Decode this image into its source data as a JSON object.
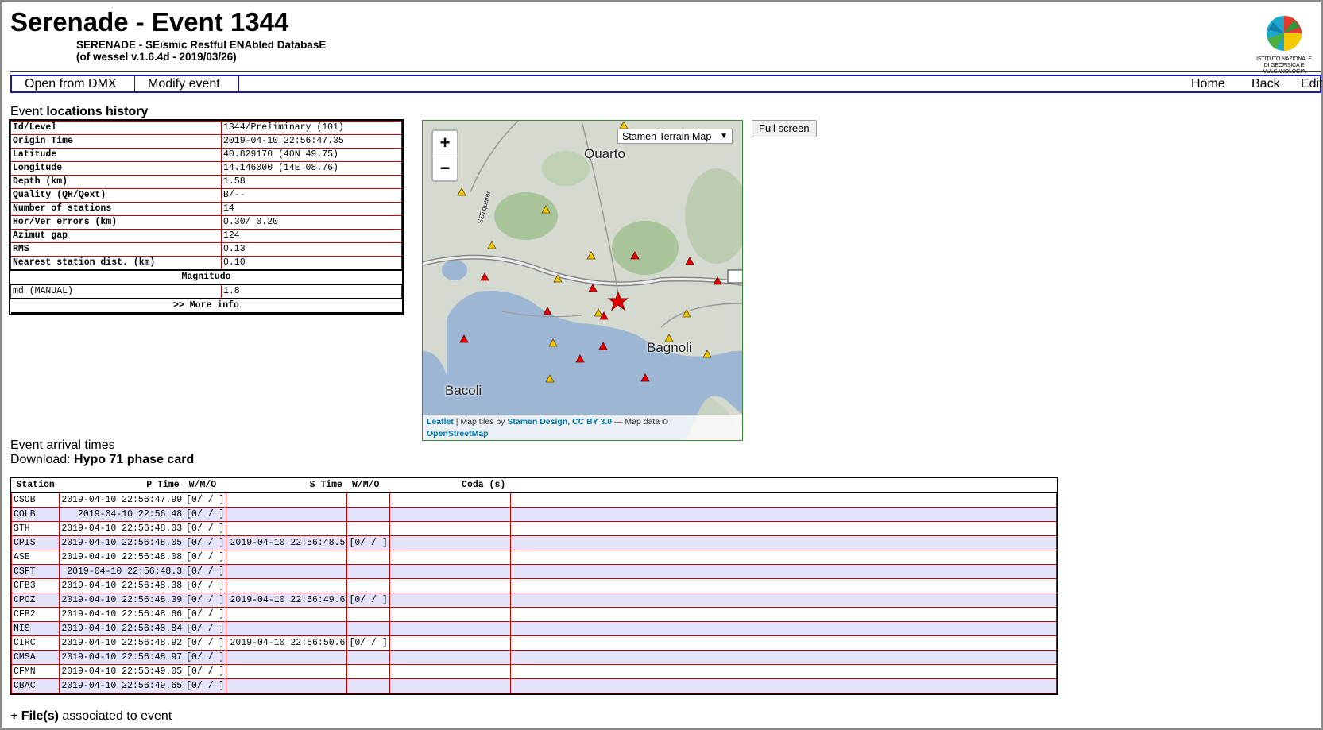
{
  "header": {
    "title": "Serenade - Event 1344",
    "subtitle_line1": "SERENADE - SEismic Restful ENAbled DatabasE",
    "subtitle_line2": "(of wessel v.1.6.4d - 2019/03/26)",
    "logo_caption1": "ISTITUTO NAZIONALE",
    "logo_caption2": "DI GEOFISICA E VULCANOLOGIA"
  },
  "menu": {
    "open_dmx": "Open from DMX",
    "modify_event": "Modify event",
    "home": "Home",
    "back": "Back",
    "editor": "Editor"
  },
  "locations": {
    "title_prefix": "Event ",
    "title_bold": "locations history",
    "rows": [
      {
        "label": "Id/Level",
        "value": "1344/Preliminary (101)"
      },
      {
        "label": "Origin Time",
        "value": "2019-04-10 22:56:47.35"
      },
      {
        "label": "Latitude",
        "value": "40.829170 (40N 49.75)"
      },
      {
        "label": "Longitude",
        "value": "14.146000 (14E 08.76)"
      },
      {
        "label": "Depth (km)",
        "value": "1.58"
      },
      {
        "label": "Quality (QH/Qext)",
        "value": "B/--"
      },
      {
        "label": "Number of stations",
        "value": "14"
      },
      {
        "label": "Hor/Ver errors (km)",
        "value": "0.30/ 0.20"
      },
      {
        "label": "Azimut gap",
        "value": "124"
      },
      {
        "label": "RMS",
        "value": "0.13"
      },
      {
        "label": "Nearest station dist. (km)",
        "value": "0.10"
      }
    ],
    "magnitudo_label": "Magnitudo",
    "magnitude": {
      "label": "md (MANUAL)",
      "value": "1.8"
    },
    "more_info": ">> More info"
  },
  "map": {
    "zoom_in": "+",
    "zoom_out": "−",
    "layer": "Stamen Terrain Map",
    "places": {
      "quarto": "Quarto",
      "bagnoli": "Bagnoli",
      "bacoli": "Bacoli",
      "road": "SS7quater"
    },
    "attribution_leaflet": "Leaflet",
    "attribution_mid": " | Map tiles by ",
    "attribution_stamen": "Stamen Design, CC BY 3.0",
    "attribution_tail": " — Map data ©",
    "attribution_osm": "OpenStreetMap",
    "colors": {
      "sea": "#9db6d3",
      "land": "#d5dbd2",
      "active": "#e00000",
      "inactive": "#f5c400"
    }
  },
  "fullscreen_label": "Full screen",
  "arrivals": {
    "title": "Event arrival times",
    "download_prefix": "Download: ",
    "download_link": "Hypo 71 phase card",
    "columns": {
      "station": "Station",
      "p_time": "P Time",
      "p_wmo": "W/M/O",
      "s_time": "S Time",
      "s_wmo": "W/M/O",
      "coda": "Coda (s)"
    },
    "rows": [
      {
        "station": "CSOB",
        "p_time": "2019-04-10 22:56:47.99",
        "p_wmo": "[0/ / ]",
        "s_time": "",
        "s_wmo": "",
        "coda": ""
      },
      {
        "station": "COLB",
        "p_time": "2019-04-10 22:56:48",
        "p_wmo": "[0/ / ]",
        "s_time": "",
        "s_wmo": "",
        "coda": ""
      },
      {
        "station": "STH",
        "p_time": "2019-04-10 22:56:48.03",
        "p_wmo": "[0/ / ]",
        "s_time": "",
        "s_wmo": "",
        "coda": ""
      },
      {
        "station": "CPIS",
        "p_time": "2019-04-10 22:56:48.05",
        "p_wmo": "[0/ / ]",
        "s_time": "2019-04-10 22:56:48.5",
        "s_wmo": "[0/ / ]",
        "coda": ""
      },
      {
        "station": "ASE",
        "p_time": "2019-04-10 22:56:48.08",
        "p_wmo": "[0/ / ]",
        "s_time": "",
        "s_wmo": "",
        "coda": ""
      },
      {
        "station": "CSFT",
        "p_time": "2019-04-10 22:56:48.3",
        "p_wmo": "[0/ / ]",
        "s_time": "",
        "s_wmo": "",
        "coda": ""
      },
      {
        "station": "CFB3",
        "p_time": "2019-04-10 22:56:48.38",
        "p_wmo": "[0/ / ]",
        "s_time": "",
        "s_wmo": "",
        "coda": ""
      },
      {
        "station": "CPOZ",
        "p_time": "2019-04-10 22:56:48.39",
        "p_wmo": "[0/ / ]",
        "s_time": "2019-04-10 22:56:49.6",
        "s_wmo": "[0/ / ]",
        "coda": ""
      },
      {
        "station": "CFB2",
        "p_time": "2019-04-10 22:56:48.66",
        "p_wmo": "[0/ / ]",
        "s_time": "",
        "s_wmo": "",
        "coda": ""
      },
      {
        "station": "NIS",
        "p_time": "2019-04-10 22:56:48.84",
        "p_wmo": "[0/ / ]",
        "s_time": "",
        "s_wmo": "",
        "coda": ""
      },
      {
        "station": "CIRC",
        "p_time": "2019-04-10 22:56:48.92",
        "p_wmo": "[0/ / ]",
        "s_time": "2019-04-10 22:56:50.6",
        "s_wmo": "[0/ / ]",
        "coda": ""
      },
      {
        "station": "CMSA",
        "p_time": "2019-04-10 22:56:48.97",
        "p_wmo": "[0/ / ]",
        "s_time": "",
        "s_wmo": "",
        "coda": ""
      },
      {
        "station": "CFMN",
        "p_time": "2019-04-10 22:56:49.05",
        "p_wmo": "[0/ / ]",
        "s_time": "",
        "s_wmo": "",
        "coda": ""
      },
      {
        "station": "CBAC",
        "p_time": "2019-04-10 22:56:49.65",
        "p_wmo": "[0/ / ]",
        "s_time": "",
        "s_wmo": "",
        "coda": ""
      }
    ]
  },
  "files": {
    "prefix": "+ ",
    "bold": "File(s)",
    "suffix": " associated to event"
  }
}
